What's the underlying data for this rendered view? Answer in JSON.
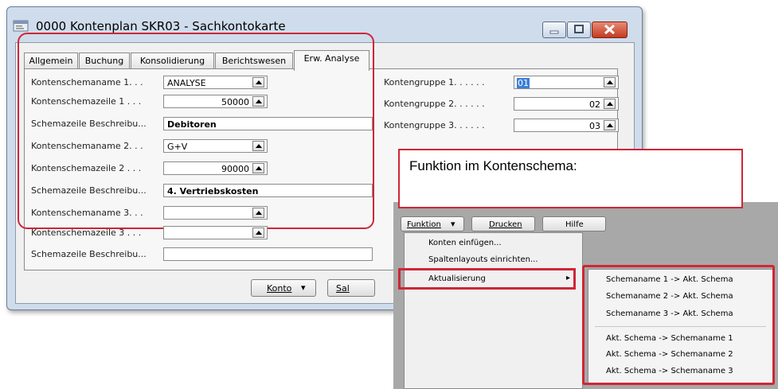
{
  "window": {
    "title": "0000 Kontenplan SKR03 - Sachkontokarte"
  },
  "tabs": [
    {
      "label": "Allgemein"
    },
    {
      "label": "Buchung"
    },
    {
      "label": "Konsolidierung"
    },
    {
      "label": "Berichtswesen"
    },
    {
      "label": "Erw. Analyse"
    }
  ],
  "left_fields": [
    {
      "label": "Kontenschemaname 1. . .",
      "value": "ANALYSE"
    },
    {
      "label": "Kontenschemazeile 1 . . .",
      "value": "50000"
    },
    {
      "label": "Schemazeile Beschreibu...",
      "value": "Debitoren"
    },
    {
      "label": "Kontenschemaname 2. . .",
      "value": "G+V"
    },
    {
      "label": "Kontenschemazeile 2 . . .",
      "value": "90000"
    },
    {
      "label": "Schemazeile Beschreibu...",
      "value": "4.     Vertriebskosten"
    },
    {
      "label": "Kontenschemaname 3. . .",
      "value": ""
    },
    {
      "label": "Kontenschemazeile 3 . . .",
      "value": ""
    },
    {
      "label": "Schemazeile Beschreibu...",
      "value": ""
    }
  ],
  "right_fields": [
    {
      "label": "Kontengruppe 1. . . . . .",
      "value": "01"
    },
    {
      "label": "Kontengruppe 2. . . . . .",
      "value": "02"
    },
    {
      "label": "Kontengruppe 3. . . . . .",
      "value": "03"
    }
  ],
  "buttons": {
    "konto": "Konto",
    "sal": "Sal",
    "funktion": "Funktion",
    "drucken": "Drucken",
    "hilfe": "Hilfe"
  },
  "callout": {
    "text": "Funktion im Kontenschema:"
  },
  "menu": {
    "items": [
      {
        "label": "Konten einfügen..."
      },
      {
        "label": "Spaltenlayouts einrichten..."
      },
      {
        "label": "Aktualisierung",
        "arrow": "▸"
      }
    ]
  },
  "submenu": {
    "items": [
      {
        "label": "Schemaname 1 -> Akt. Schema"
      },
      {
        "label": "Schemaname 2 -> Akt. Schema"
      },
      {
        "label": "Schemaname 3 -> Akt. Schema"
      },
      {
        "label": "Akt. Schema -> Schemaname 1"
      },
      {
        "label": "Akt. Schema -> Schemaname 2"
      },
      {
        "label": "Akt. Schema -> Schemaname 3"
      }
    ]
  },
  "colors": {
    "highlight_red": "#cf2636",
    "window_frame": "#cfdcec"
  }
}
